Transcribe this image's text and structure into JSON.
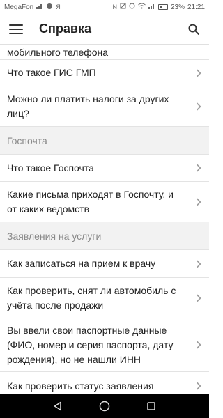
{
  "status_bar": {
    "carrier": "MegaFon",
    "left_icons": [
      "signal-icon",
      "chat-icon",
      "yandex-icon"
    ],
    "right_icons": [
      "nfc-icon",
      "mute-icon",
      "alarm-icon",
      "wifi-icon",
      "signal-icon"
    ],
    "battery_percent": "23%",
    "time": "21:21",
    "glyph_n": "N",
    "glyph_y": "Я"
  },
  "app_bar": {
    "title": "Справка"
  },
  "list": {
    "partial_item": "мобильного телефона",
    "item_gis": "Что такое ГИС ГМП",
    "item_taxes": "Можно ли платить налоги за других лиц?",
    "section_gospochta": "Госпочта",
    "item_gospochta": "Что такое Госпочта",
    "item_letters": "Какие письма приходят в Госпочту, и от каких ведомств",
    "section_applications": "Заявления на услуги",
    "item_doctor": "Как записаться на прием к врачу",
    "item_car": "Как проверить, снят ли автомобиль с учёта после продажи",
    "item_inn": "Вы ввели свои паспортные данные (ФИО, номер и серия паспорта, дату рождения), но не нашли ИНН",
    "item_status": "Как проверить статус заявления"
  },
  "colors": {
    "section_bg": "#f2f2f2",
    "section_text": "#8a8a8a",
    "divider": "#e3e3e3",
    "navbar_bg": "#000000"
  }
}
